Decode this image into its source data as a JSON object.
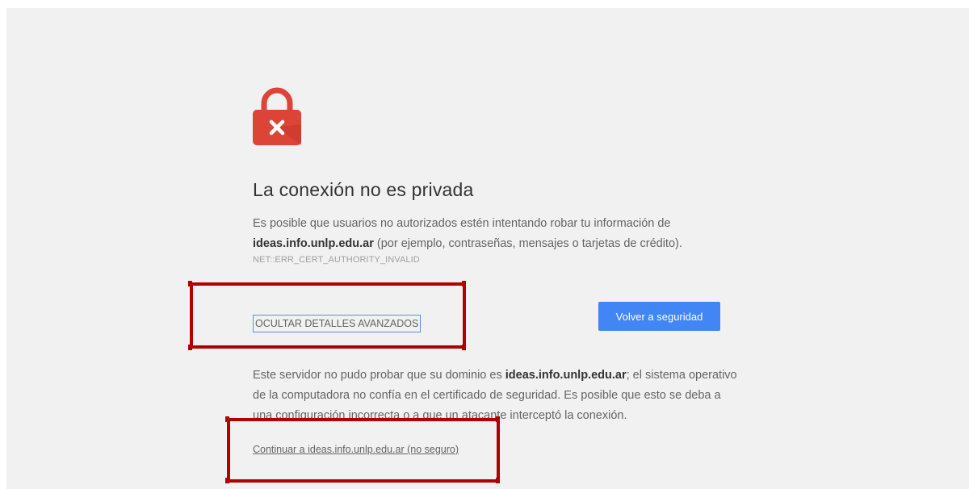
{
  "icons": {
    "lock": "lock-error-icon",
    "lock_color": "#db4437",
    "mark": "×"
  },
  "interstitial": {
    "title": "La conexión no es privada",
    "desc_prefix": "Es posible que usuarios no autorizados estén intentando robar tu información de ",
    "domain": "ideas.info.unlp.edu.ar",
    "desc_suffix": " (por ejemplo, contraseñas, mensajes o tarjetas de crédito).",
    "error_code": "NET::ERR_CERT_AUTHORITY_INVALID",
    "details_button": "OCULTAR DETALLES AVANZADOS",
    "primary_button": "Volver a seguridad",
    "detail_prefix": "Este servidor no pudo probar que su dominio es ",
    "detail_suffix": "; el sistema operativo de la computadora no confía en el certificado de seguridad. Es posible que esto se deba a una configuración incorrecta o a que un atacante interceptó la conexión.",
    "proceed_link": "Continuar a ideas.info.unlp.edu.ar (no seguro)"
  },
  "colors": {
    "primary_button": "#4285f4",
    "highlight": "#b00000",
    "background": "#f1f1f1"
  }
}
